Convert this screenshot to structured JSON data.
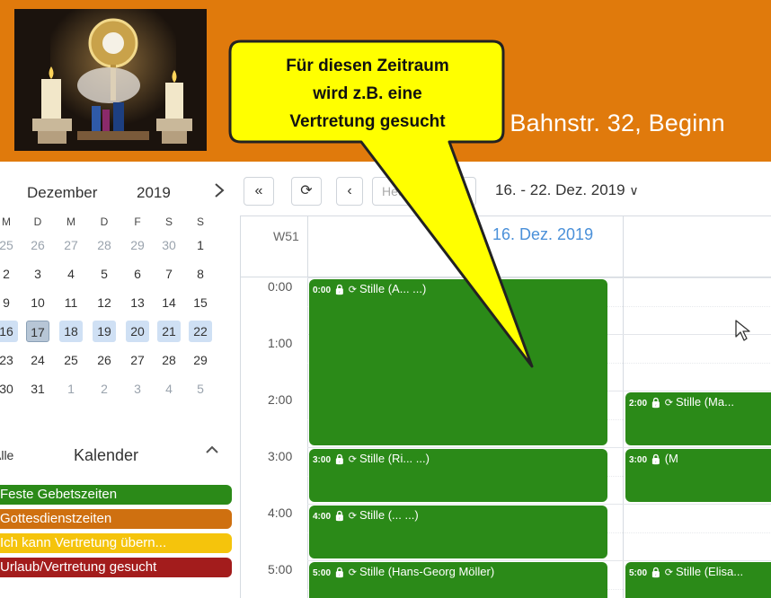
{
  "header": {
    "title": ", Bahnstr. 32, Beginn",
    "image_alt": "candles-and-monstrance"
  },
  "mini_calendar": {
    "month": "Dezember",
    "year": "2019",
    "next_icon": "chevron-right-icon",
    "weekdays": [
      "M",
      "D",
      "M",
      "D",
      "F",
      "S",
      "S"
    ],
    "weeks": [
      [
        "25",
        "26",
        "27",
        "28",
        "29",
        "30",
        "1"
      ],
      [
        "2",
        "3",
        "4",
        "5",
        "6",
        "7",
        "8"
      ],
      [
        "9",
        "10",
        "11",
        "12",
        "13",
        "14",
        "15"
      ],
      [
        "16",
        "17",
        "18",
        "19",
        "20",
        "21",
        "22"
      ],
      [
        "23",
        "24",
        "25",
        "26",
        "27",
        "28",
        "29"
      ],
      [
        "30",
        "31",
        "1",
        "2",
        "3",
        "4",
        "5"
      ]
    ],
    "today": "17",
    "selected_week_index": 3
  },
  "calendars": {
    "alle_label": "Alle",
    "title": "Kalender",
    "collapse_icon": "chevron-up-icon",
    "items": [
      {
        "label": "Feste Gebetszeiten",
        "color": "#2b8a18"
      },
      {
        "label": "Gottesdienstzeiten",
        "color": "#cf7010"
      },
      {
        "label": "Ich kann Vertretung übern...",
        "color": "#f5c40c"
      },
      {
        "label": "Urlaub/Vertretung gesucht",
        "color": "#a31c1c"
      }
    ]
  },
  "toolbar": {
    "prev_range_icon": "double-chevron-left-icon",
    "refresh_icon": "refresh-icon",
    "prev_icon": "chevron-left-icon",
    "today_label": "Heute",
    "range_label": "16. - 22. Dez. 2019",
    "range_dropdown_icon": "chevron-down-icon"
  },
  "week_view": {
    "week_number": "W51",
    "day_title": "16. Dez. 2019",
    "hours": [
      "0:00",
      "1:00",
      "2:00",
      "3:00",
      "4:00",
      "5:00"
    ],
    "events": [
      {
        "time": "0:00",
        "title": "Stille (A... ...)",
        "column": 0,
        "start": 0,
        "end": 3
      },
      {
        "time": "3:00",
        "title": "Stille (Ri... ...)",
        "column": 0,
        "start": 3,
        "end": 4
      },
      {
        "time": "4:00",
        "title": "Stille (... ...)",
        "column": 0,
        "start": 4,
        "end": 5
      },
      {
        "time": "5:00",
        "title": "Stille (Hans-Georg Möller)",
        "column": 0,
        "start": 5,
        "end": 6
      },
      {
        "time": "2:00",
        "title": "Stille (Ma...",
        "column": 1,
        "start": 2,
        "end": 3
      },
      {
        "time": "3:00",
        "title": "(M",
        "column": 1,
        "start": 3,
        "end": 4
      },
      {
        "time": "5:00",
        "title": "Stille (Elisa...",
        "column": 1,
        "start": 5,
        "end": 6
      }
    ]
  },
  "callout": {
    "lines": [
      "Für diesen Zeitraum",
      "wird z.B. eine",
      "Vertretung gesucht"
    ],
    "fill": "#ffff00",
    "stroke": "#222222"
  },
  "icons": {
    "lock": "lock-icon",
    "repeat": "repeat-icon",
    "cursor": "mouse-cursor-icon"
  }
}
